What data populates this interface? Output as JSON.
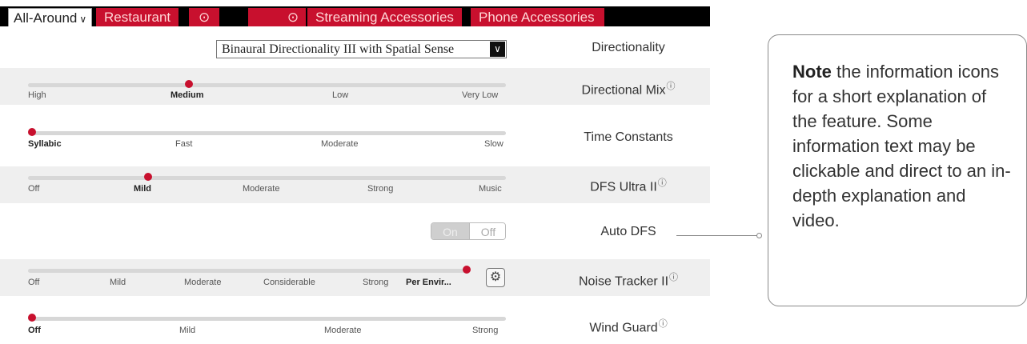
{
  "tabs": {
    "active": "All-Around",
    "items": [
      "Restaurant",
      "⊙",
      "⊙",
      "Streaming Accessories",
      "Phone Accessories"
    ]
  },
  "directionality": {
    "label": "Directionality",
    "selected": "Binaural Directionality III with Spatial Sense"
  },
  "directional_mix": {
    "label": "Directional Mix",
    "ticks": [
      "High",
      "Medium",
      "Low",
      "Very Low"
    ],
    "selected": "Medium"
  },
  "time_constants": {
    "label": "Time Constants",
    "ticks": [
      "Syllabic",
      "Fast",
      "Moderate",
      "Slow"
    ],
    "selected": "Syllabic"
  },
  "dfs_ultra": {
    "label": "DFS Ultra II",
    "ticks": [
      "Off",
      "Mild",
      "Moderate",
      "Strong",
      "Music"
    ],
    "selected": "Mild"
  },
  "auto_dfs": {
    "label": "Auto DFS",
    "on_label": "On",
    "off_label": "Off"
  },
  "noise_tracker": {
    "label": "Noise Tracker II",
    "ticks": [
      "Off",
      "Mild",
      "Moderate",
      "Considerable",
      "Strong",
      "Per Envir..."
    ],
    "selected": "Per Envir..."
  },
  "wind_guard": {
    "label": "Wind Guard",
    "ticks": [
      "Off",
      "Mild",
      "Moderate",
      "Strong"
    ],
    "selected": "Off"
  },
  "icons": {
    "info": "ⓘ",
    "chevron": "∨",
    "select_arrow": "∨",
    "gear": "⚙"
  },
  "note": {
    "lead": "Note",
    "body": " the information icons for a short explanation of the feature. Some information text may be clickable and direct to an in-depth explanation and video."
  },
  "colors": {
    "accent": "#c8102e",
    "tab_bar": "#000000",
    "row_shade": "#efefef"
  }
}
